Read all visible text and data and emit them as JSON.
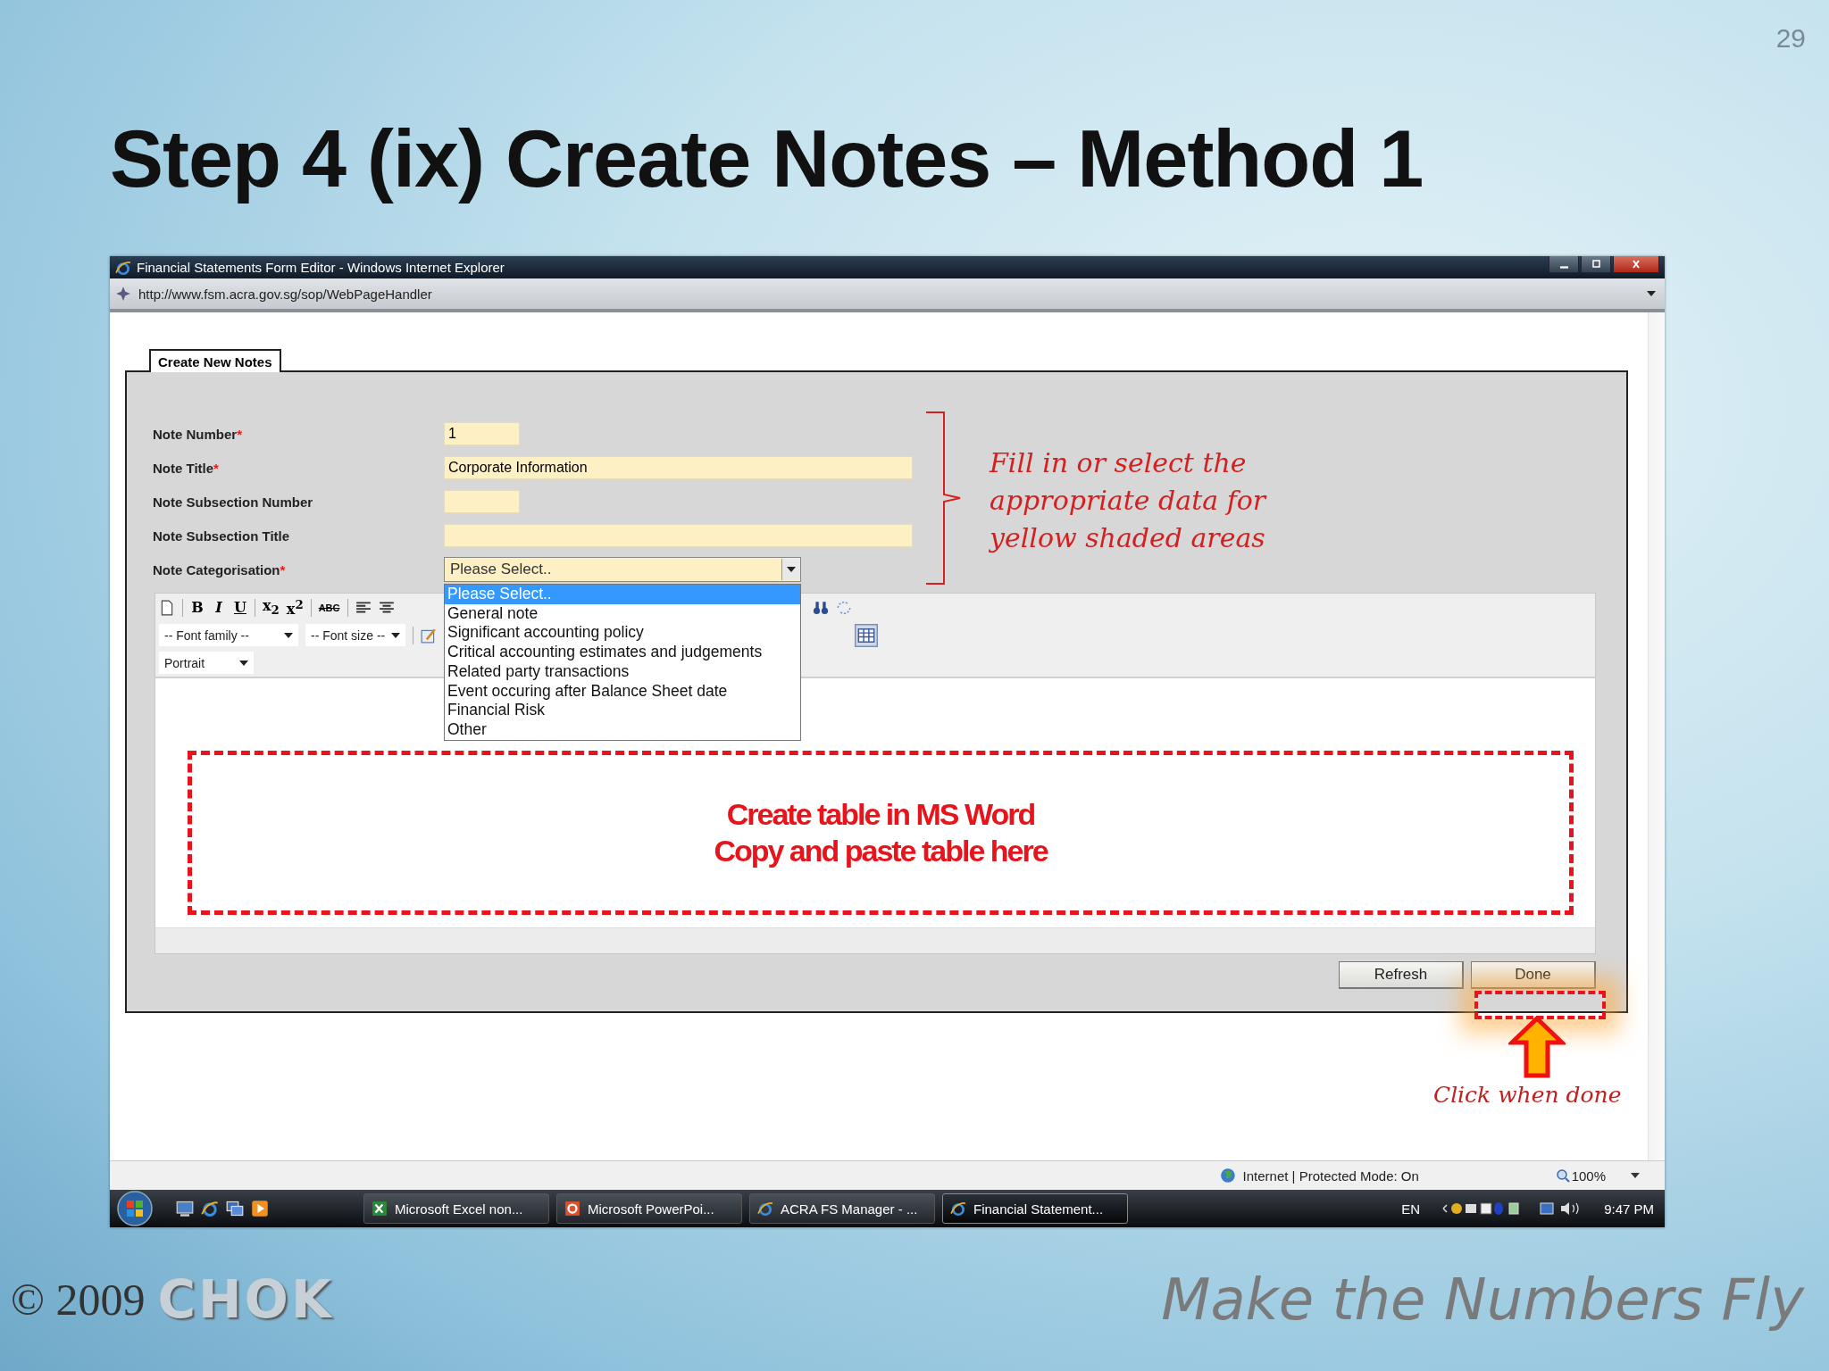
{
  "slide": {
    "page_number": "29",
    "title": "Step 4 (ix) Create Notes – Method 1",
    "copyright": "© 2009",
    "logo": "CHOK",
    "tagline": "Make the Numbers Fly"
  },
  "window": {
    "title": "Financial Statements Form Editor - Windows Internet Explorer",
    "address": "http://www.fsm.acra.gov.sg/sop/WebPageHandler",
    "tab": "Create New Notes",
    "fields": [
      {
        "label": "Note Number",
        "marker": "*",
        "value": "1",
        "kind": "short"
      },
      {
        "label": "Note Title",
        "marker": "*",
        "value": "Corporate Information",
        "kind": "wide"
      },
      {
        "label": "Note Subsection Number",
        "kind": "short"
      },
      {
        "label": "Note Subsection Title",
        "kind": "wide"
      }
    ],
    "category": {
      "label": "Note Categorisation",
      "marker": "*",
      "value": "Please Select..",
      "options": [
        {
          "label": "Please Select..",
          "selected": true
        },
        {
          "label": "General note",
          "selected": false
        },
        {
          "label": "Significant accounting policy",
          "selected": false
        },
        {
          "label": "Critical accounting estimates and judgements",
          "selected": false
        },
        {
          "label": "Related party transactions",
          "selected": false
        },
        {
          "label": "Event occuring after Balance Sheet date",
          "selected": false
        },
        {
          "label": "Financial Risk",
          "selected": false
        },
        {
          "label": "Other",
          "selected": false
        }
      ]
    },
    "toolbar": [
      {
        "label": "B",
        "kind": "bold"
      },
      {
        "label": "I",
        "kind": "italic"
      },
      {
        "label": "U",
        "kind": "underline"
      },
      {
        "label": "x$_{2}$",
        "kind": "sub"
      },
      {
        "label": "x$^{2}$",
        "kind": "sup"
      },
      {
        "label": "ABC",
        "kind": "strike"
      }
    ],
    "font_family": "-- Font family --",
    "font_size": "-- Font size --",
    "orientation": "Portrait",
    "buttons": [
      "Refresh",
      "Done"
    ],
    "status": {
      "zone": "Internet | Protected Mode: On",
      "zoom": "100%"
    }
  },
  "taskbar": {
    "items": [
      {
        "label": "Microsoft Excel non...",
        "kind": "excel",
        "selected": false
      },
      {
        "label": "Microsoft PowerPoi...",
        "kind": "powerpoint",
        "selected": false
      },
      {
        "label": "ACRA FS Manager - ...",
        "kind": "browser",
        "selected": false
      },
      {
        "label": "Financial Statement...",
        "kind": "browser",
        "selected": true
      }
    ],
    "language": "EN",
    "clock": "9:47 PM"
  },
  "annotations": {
    "fields_note": [
      "Fill in or select the",
      "appropriate data for",
      "yellow shaded areas"
    ],
    "table_note": [
      "Create table in MS Word",
      "Copy and paste table here"
    ],
    "done_note": "Click when done"
  }
}
